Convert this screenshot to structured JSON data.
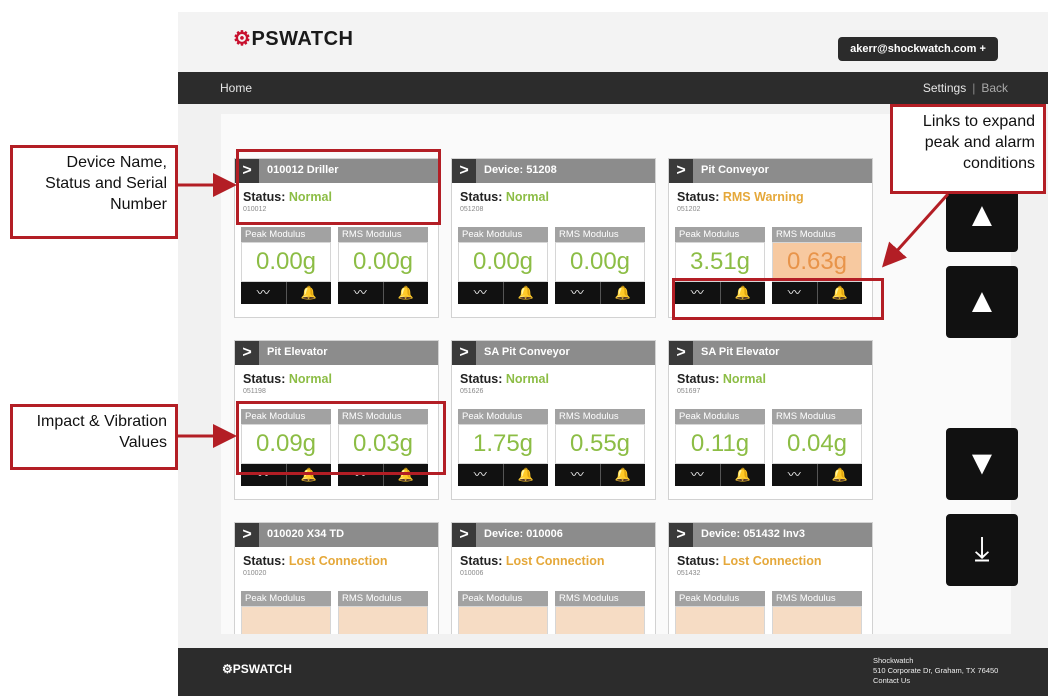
{
  "header": {
    "logo": "PSWATCH",
    "logo_mark": "⚙",
    "user": "akerr@shockwatch.com  +"
  },
  "nav": {
    "home": "Home",
    "settings": "Settings",
    "sep": "|",
    "back": "Back"
  },
  "cards": [
    {
      "name": "010012 Driller",
      "status_label": "Status:",
      "status": "Normal",
      "serial": "010012",
      "peak_label": "Peak Modulus",
      "rms_label": "RMS Modulus",
      "peak": "0.00g",
      "rms": "0.00g"
    },
    {
      "name": "Device: 51208",
      "status_label": "Status:",
      "status": "Normal",
      "serial": "051208",
      "peak_label": "Peak Modulus",
      "rms_label": "RMS Modulus",
      "peak": "0.00g",
      "rms": "0.00g"
    },
    {
      "name": "Pit Conveyor",
      "status_label": "Status:",
      "status": "RMS Warning",
      "serial": "051202",
      "peak_label": "Peak Modulus",
      "rms_label": "RMS Modulus",
      "peak": "3.51g",
      "rms": "0.63g"
    },
    {
      "name": "Pit Elevator",
      "status_label": "Status:",
      "status": "Normal",
      "serial": "051198",
      "peak_label": "Peak Modulus",
      "rms_label": "RMS Modulus",
      "peak": "0.09g",
      "rms": "0.03g"
    },
    {
      "name": "SA Pit Conveyor",
      "status_label": "Status:",
      "status": "Normal",
      "serial": "051626",
      "peak_label": "Peak Modulus",
      "rms_label": "RMS Modulus",
      "peak": "1.75g",
      "rms": "0.55g"
    },
    {
      "name": "SA Pit Elevator",
      "status_label": "Status:",
      "status": "Normal",
      "serial": "051697",
      "peak_label": "Peak Modulus",
      "rms_label": "RMS Modulus",
      "peak": "0.11g",
      "rms": "0.04g"
    },
    {
      "name": "010020 X34 TD",
      "status_label": "Status:",
      "status": "Lost Connection",
      "serial": "010020",
      "peak_label": "Peak Modulus",
      "rms_label": "RMS Modulus",
      "peak": "",
      "rms": ""
    },
    {
      "name": "Device: 010006",
      "status_label": "Status:",
      "status": "Lost Connection",
      "serial": "010006",
      "peak_label": "Peak Modulus",
      "rms_label": "RMS Modulus",
      "peak": "",
      "rms": ""
    },
    {
      "name": "Device: 051432 Inv3",
      "status_label": "Status:",
      "status": "Lost Connection",
      "serial": "051432",
      "peak_label": "Peak Modulus",
      "rms_label": "RMS Modulus",
      "peak": "",
      "rms": ""
    }
  ],
  "icons": {
    "trend": "trend-icon",
    "alarm": "bell-icon",
    "chevron": "chevron-right-icon"
  },
  "annotations": {
    "device_name": "Device Name, Status and Serial Number",
    "impact": "Impact & Vibration Values",
    "links": "Links to expand peak and alarm conditions"
  },
  "footer": {
    "logo": "PSWATCH",
    "company": "Shockwatch",
    "address": "510 Corporate Dr, Graham, TX 76450",
    "contact": "Contact Us"
  },
  "colors": {
    "accent_red": "#b31e25",
    "normal": "#8cbd45",
    "warning": "#e5a83a",
    "nav": "#2c2c2c"
  }
}
